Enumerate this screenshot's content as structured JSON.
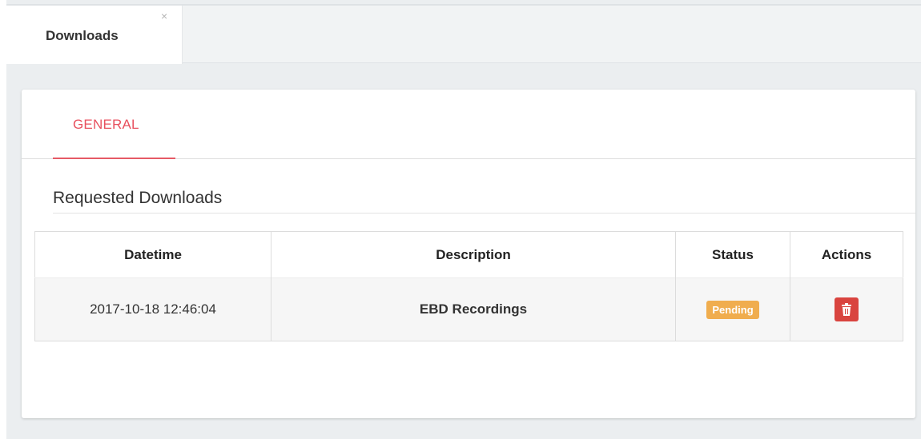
{
  "tabs": [
    {
      "label": "Downloads",
      "close_glyph": "×",
      "active": true
    }
  ],
  "panel": {
    "subtab": "GENERAL",
    "section_title": "Requested Downloads",
    "table": {
      "columns": [
        "Datetime",
        "Description",
        "Status",
        "Actions"
      ],
      "rows": [
        {
          "datetime": "2017-10-18 12:46:04",
          "description": "EBD Recordings",
          "status": "Pending",
          "action_icon": "trash-icon"
        }
      ]
    }
  },
  "colors": {
    "accent": "#e8515f",
    "status_pending": "#f0ad4e",
    "delete_button": "#d9443f"
  }
}
